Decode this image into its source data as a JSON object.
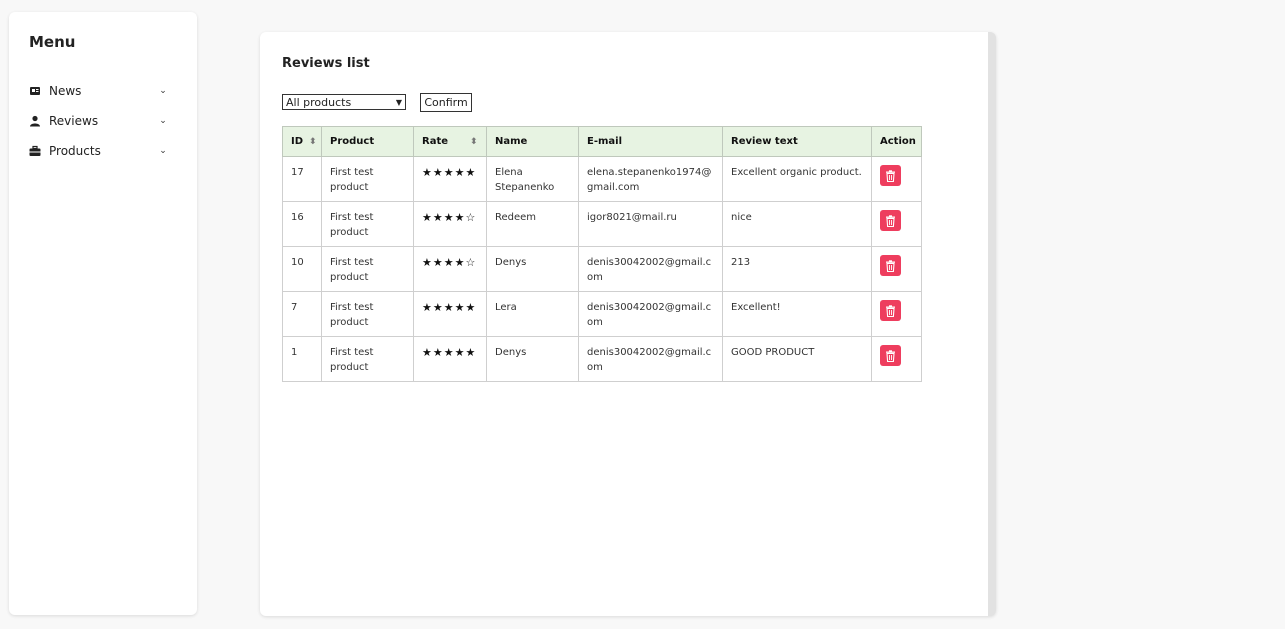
{
  "sidebar": {
    "title": "Menu",
    "items": [
      {
        "label": "News",
        "icon": "newspaper-icon"
      },
      {
        "label": "Reviews",
        "icon": "user-icon"
      },
      {
        "label": "Products",
        "icon": "briefcase-icon"
      }
    ]
  },
  "main": {
    "title": "Reviews list",
    "filter": {
      "selected": "All products"
    },
    "confirm_label": "Confirm",
    "table": {
      "headers": [
        "ID",
        "Product",
        "Rate",
        "Name",
        "E-mail",
        "Review text",
        "Action"
      ],
      "rows": [
        {
          "id": "17",
          "product": "First test product",
          "rate": 5,
          "name": "Elena Stepanenko",
          "email": "elena.stepanenko1974@gmail.com",
          "review": "Excellent organic product."
        },
        {
          "id": "16",
          "product": "First test product",
          "rate": 4,
          "name": "Redeem",
          "email": "igor8021@mail.ru",
          "review": "nice"
        },
        {
          "id": "10",
          "product": "First test product",
          "rate": 4,
          "name": "Denys",
          "email": "denis30042002@gmail.com",
          "review": "213"
        },
        {
          "id": "7",
          "product": "First test product",
          "rate": 5,
          "name": "Lera",
          "email": "denis30042002@gmail.com",
          "review": "Excellent!"
        },
        {
          "id": "1",
          "product": "First test product",
          "rate": 5,
          "name": "Denys",
          "email": "denis30042002@gmail.com",
          "review": "GOOD PRODUCT"
        }
      ]
    }
  },
  "colors": {
    "header_bg": "#e7f3e2",
    "delete_button": "#ee3d5e",
    "page_bg": "#f8f8f8"
  }
}
